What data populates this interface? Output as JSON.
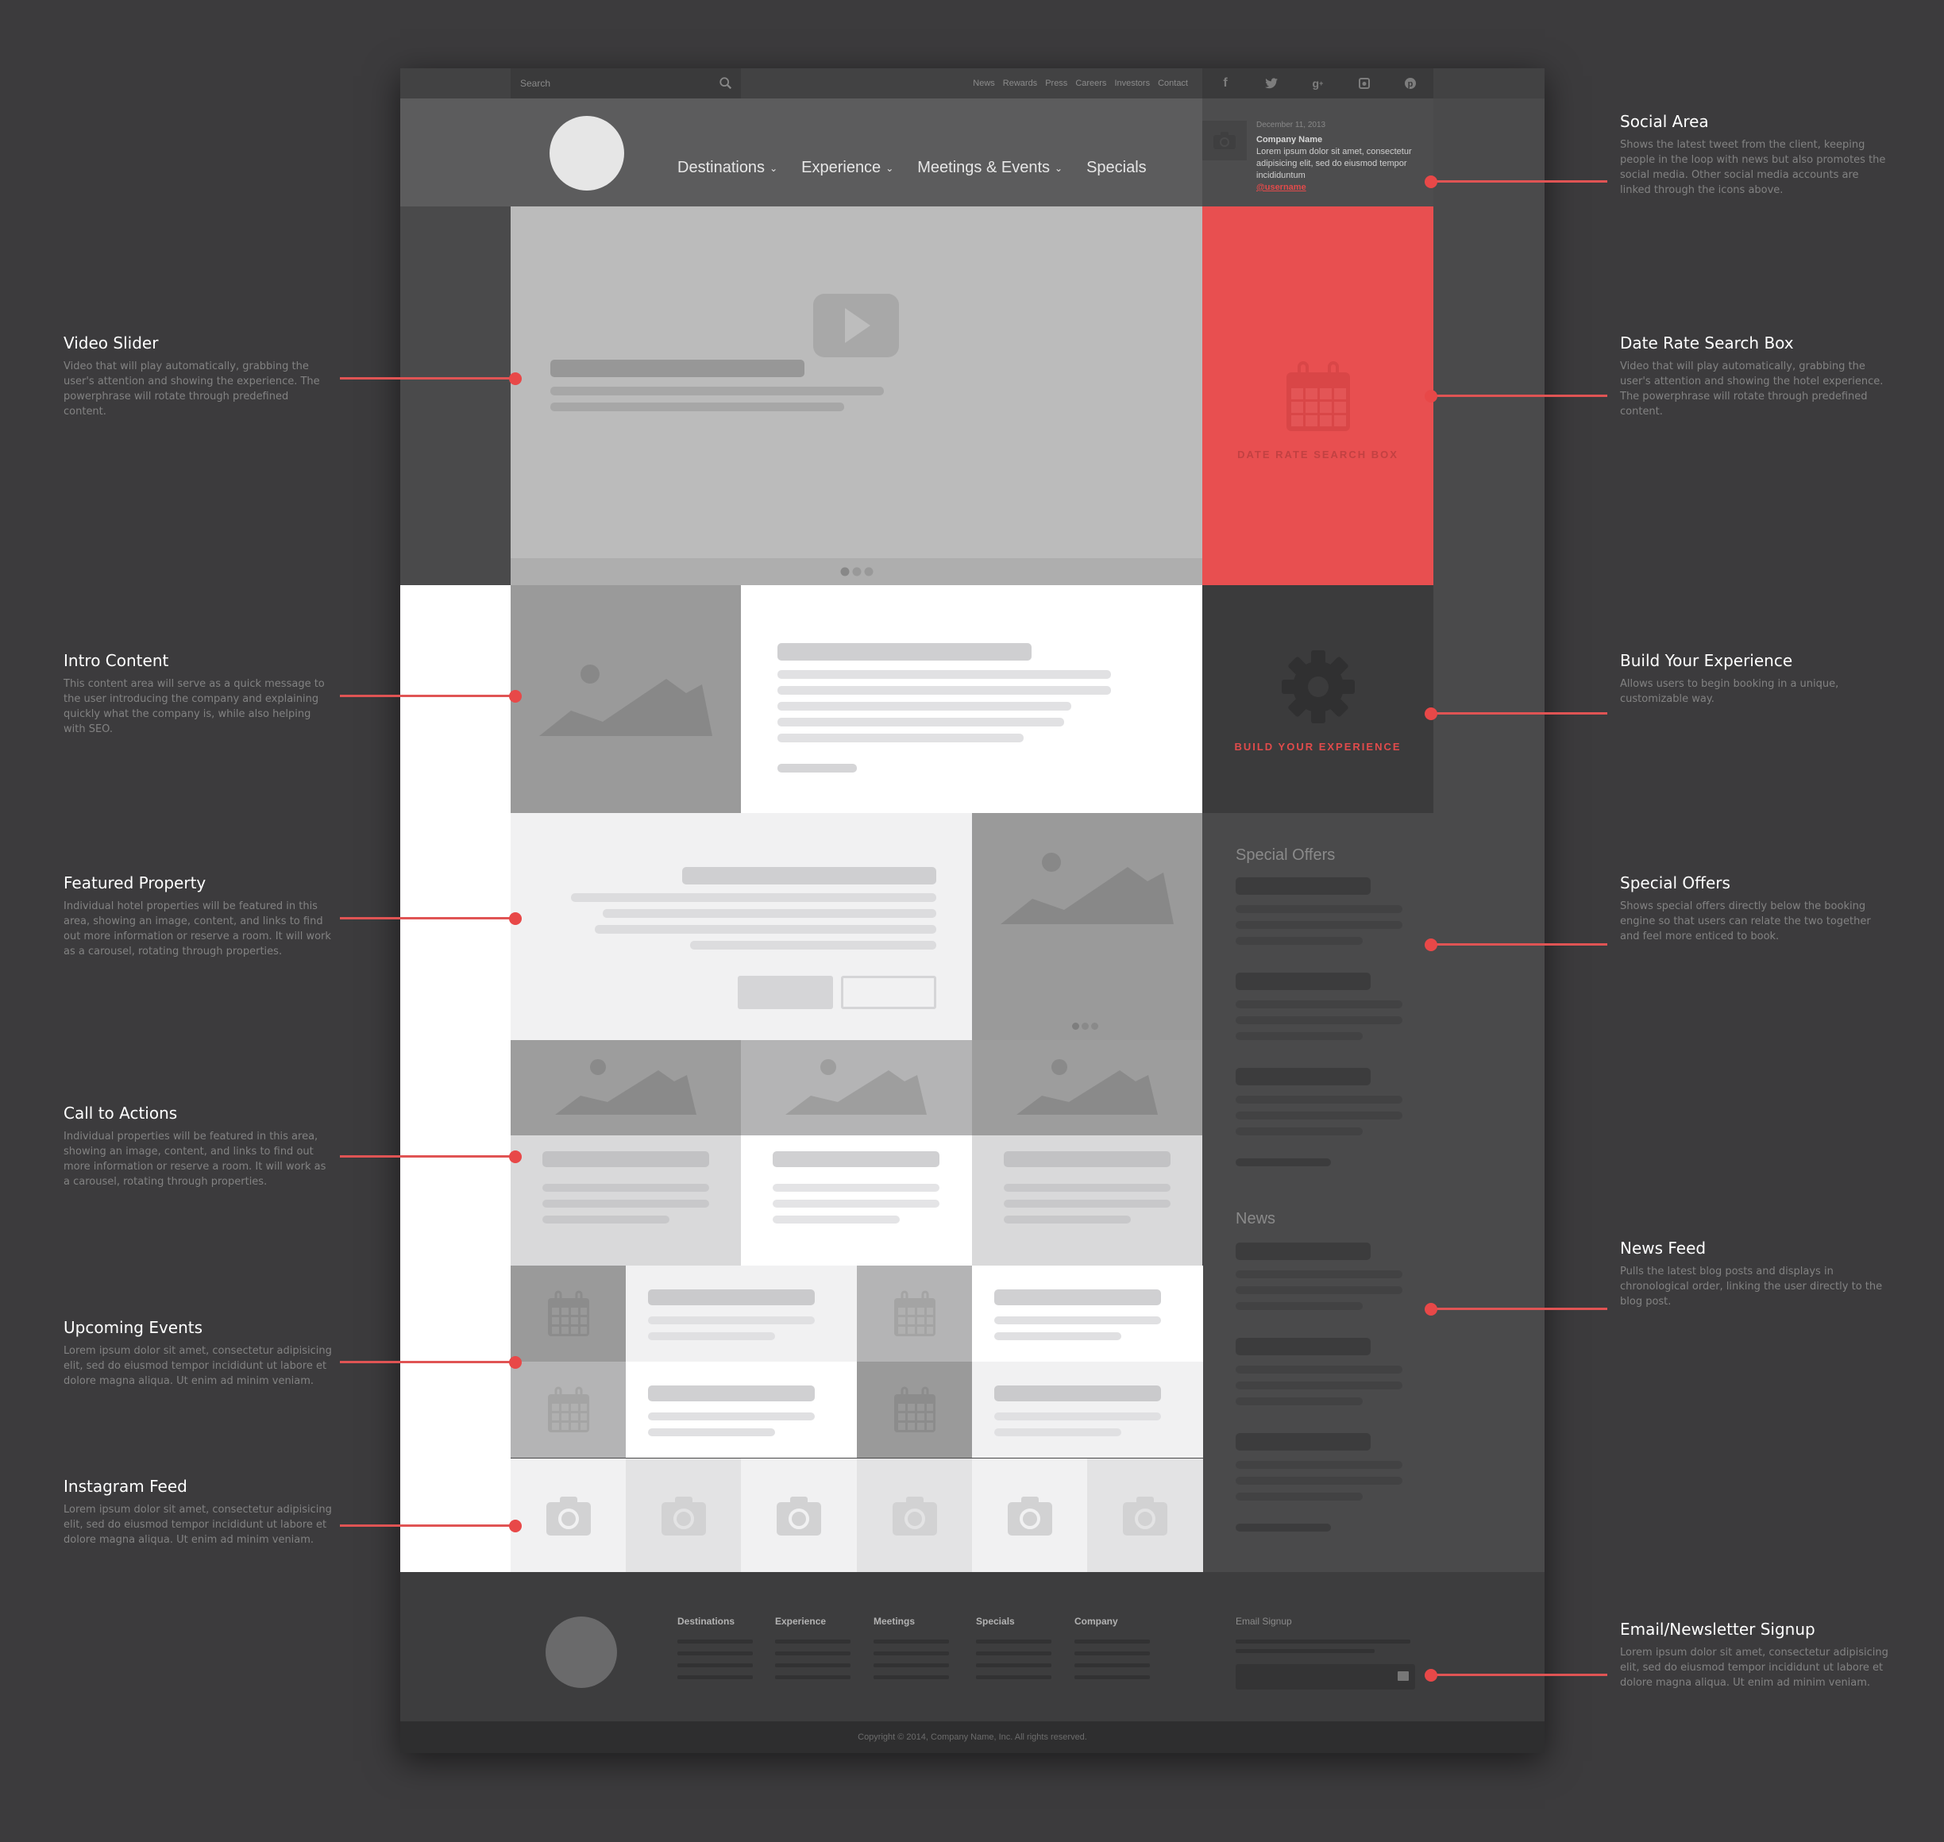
{
  "topbar": {
    "search_placeholder": "Search",
    "links": [
      "News",
      "Rewards",
      "Press",
      "Careers",
      "Investors",
      "Contact"
    ],
    "social_icons": [
      "facebook-icon",
      "twitter-icon",
      "google-plus-icon",
      "instagram-icon",
      "pinterest-icon"
    ]
  },
  "header": {
    "nav": [
      {
        "label": "Destinations",
        "dropdown": true
      },
      {
        "label": "Experience",
        "dropdown": true
      },
      {
        "label": "Meetings & Events",
        "dropdown": true
      },
      {
        "label": "Specials",
        "dropdown": false
      }
    ]
  },
  "tweet": {
    "date": "December 11, 2013",
    "company": "Company Name",
    "text": "Lorem ipsum dolor sit amet, consectetur adipisicing elit, sed do eiusmod tempor incididuntum",
    "username": "@username"
  },
  "video_slider": {
    "slides": 3,
    "active_slide": 1
  },
  "date_rate_box": {
    "label": "DATE RATE SEARCH BOX"
  },
  "build_box": {
    "label": "BUILD YOUR EXPERIENCE"
  },
  "featured_property": {
    "slides": 3,
    "active_slide": 1
  },
  "sidebar": {
    "special_offers_title": "Special Offers",
    "news_title": "News"
  },
  "footer": {
    "columns": [
      "Destinations",
      "Experience",
      "Meetings",
      "Specials",
      "Company"
    ],
    "email_label": "Email Signup",
    "copyright": "Copyright © 2014, Company Name, Inc. All rights reserved."
  },
  "colors": {
    "accent": "#e84f50",
    "background": "#3c3b3d"
  },
  "annotations": {
    "left": [
      {
        "title": "Video Slider",
        "desc": "Video that will play automatically, grabbing the user's attention and showing the experience. The powerphrase will rotate through predefined content."
      },
      {
        "title": "Intro Content",
        "desc": "This content area will serve as a quick message to the user introducing the company and explaining quickly what the company is, while also helping with SEO."
      },
      {
        "title": "Featured Property",
        "desc": "Individual hotel properties will be featured in this area, showing an image, content, and links to find out more information or reserve a room. It will work as a carousel, rotating through properties."
      },
      {
        "title": "Call to Actions",
        "desc": "Individual properties will be featured in this area, showing an image, content, and links to find out more information or reserve a room. It will work as a carousel, rotating through properties."
      },
      {
        "title": "Upcoming Events",
        "desc": "Lorem ipsum dolor sit amet, consectetur adipisicing elit, sed do eiusmod tempor incididunt ut labore et dolore magna aliqua. Ut enim ad minim veniam."
      },
      {
        "title": "Instagram Feed",
        "desc": "Lorem ipsum dolor sit amet, consectetur adipisicing elit, sed do eiusmod tempor incididunt ut labore et dolore magna aliqua. Ut enim ad minim veniam."
      }
    ],
    "right": [
      {
        "title": "Social Area",
        "desc": "Shows the latest tweet from the client, keeping people in the loop with news but also promotes the social media. Other social media accounts are linked through the icons above."
      },
      {
        "title": "Date Rate Search Box",
        "desc": "Video that will play automatically, grabbing the user's attention and showing the hotel experience. The powerphrase will rotate through predefined content."
      },
      {
        "title": "Build Your Experience",
        "desc": "Allows users to begin booking in a unique, customizable way."
      },
      {
        "title": "Special Offers",
        "desc": "Shows special offers directly below the booking engine so that users can relate the two together and feel more enticed to book."
      },
      {
        "title": "News Feed",
        "desc": "Pulls the latest blog posts and displays in chronological order, linking the user directly to the blog post."
      },
      {
        "title": "Email/Newsletter Signup",
        "desc": "Lorem ipsum dolor sit amet, consectetur adipisicing elit, sed do eiusmod tempor incididunt ut labore et dolore magna aliqua. Ut enim ad minim veniam."
      }
    ]
  }
}
